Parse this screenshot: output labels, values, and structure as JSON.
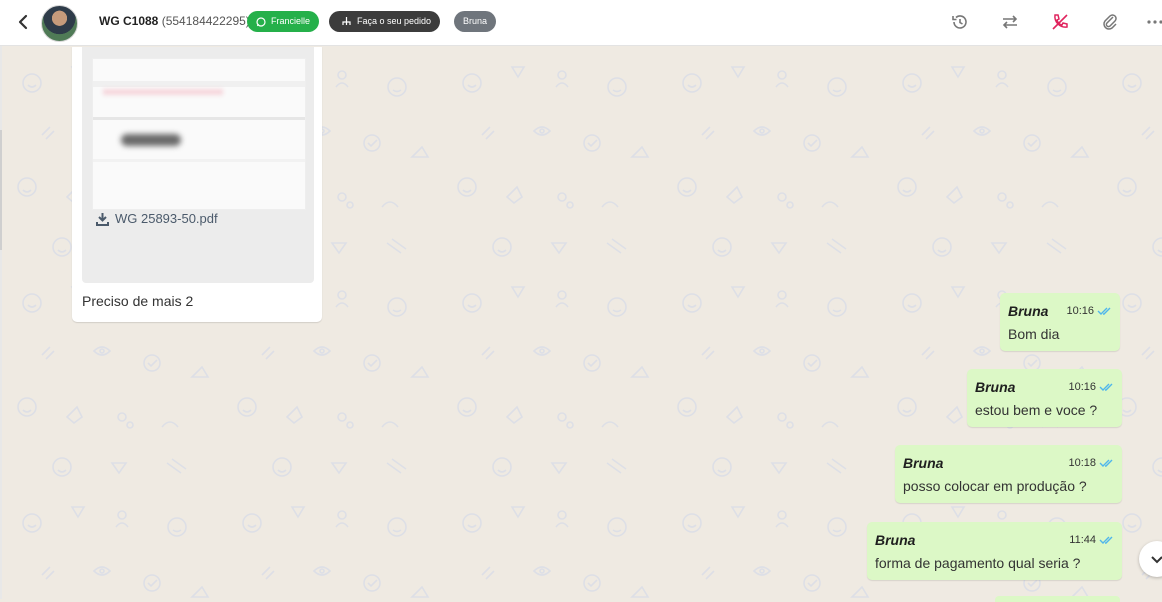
{
  "header": {
    "contact_name": "WG C1088",
    "contact_phone": "(554184422295)",
    "chips": {
      "whatsapp_label": "Francielle",
      "order_label": "Faça o seu pedido",
      "agent_label": "Bruna"
    },
    "colors": {
      "whatsapp_chip": "#25b04a",
      "order_chip": "#3c3c3c",
      "agent_chip": "#6f757c",
      "phone_off_icon": "#e0245e"
    },
    "icons": [
      "back-icon",
      "history-icon",
      "transfer-icon",
      "phone-off-icon",
      "paperclip-icon",
      "more-icon"
    ]
  },
  "chat": {
    "incoming": {
      "attachment_name": "WG 25893-50.pdf",
      "caption": "Preciso de mais 2"
    },
    "outgoing": [
      {
        "sender": "Bruna",
        "time": "10:16",
        "text": "Bom dia"
      },
      {
        "sender": "Bruna",
        "time": "10:16",
        "text": "estou bem e voce ?"
      },
      {
        "sender": "Bruna",
        "time": "10:18",
        "text": "posso colocar em produção ?"
      },
      {
        "sender": "Bruna",
        "time": "11:44",
        "text": "forma de pagamento qual seria ?"
      }
    ],
    "colors": {
      "outgoing_bubble": "#dcf8c6",
      "incoming_bubble": "#ffffff",
      "read_ticks": "#4fb6ec",
      "wallpaper": "#efeae2"
    }
  }
}
